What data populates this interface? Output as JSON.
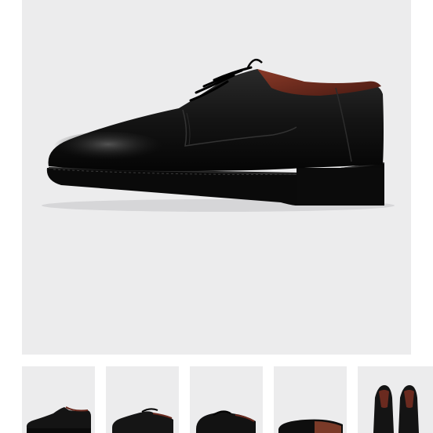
{
  "gallery": {
    "main_image": {
      "subject": "black-leather-derby-shoe",
      "background_color": "#ececed",
      "active_thumbnail_index": 0
    },
    "thumbnails": [
      {
        "view": "side-profile",
        "selected": true
      },
      {
        "view": "front-three-quarter",
        "selected": false
      },
      {
        "view": "top-three-quarter",
        "selected": false
      },
      {
        "view": "sole",
        "selected": false
      },
      {
        "view": "pair-front",
        "selected": false
      }
    ],
    "colors": {
      "leather": "#141414",
      "lining": "#6a2a1f",
      "sole": "#0c0c0c"
    }
  }
}
